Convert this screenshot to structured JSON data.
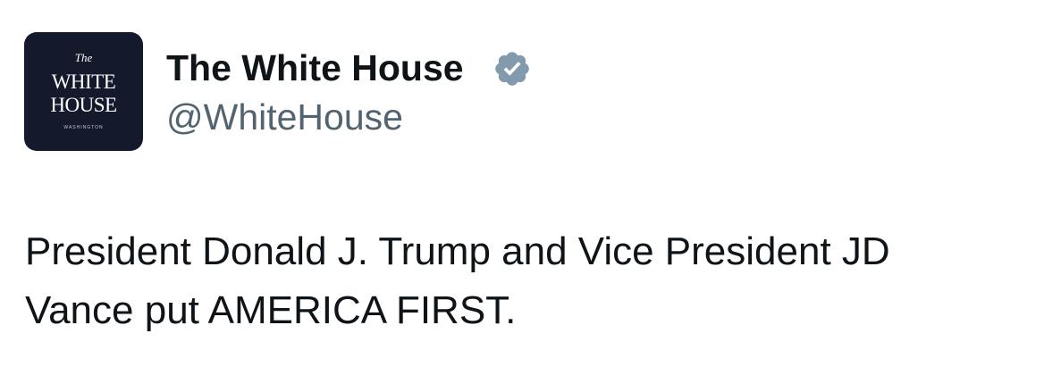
{
  "tweet": {
    "avatar": {
      "line_the": "The",
      "line_white": "WHITE",
      "line_house": "HOUSE",
      "line_location": "WASHINGTON",
      "background": "#141a2c"
    },
    "author": {
      "display_name": "The White House",
      "handle": "@WhiteHouse",
      "verified_icon": "verified-badge-icon",
      "badge_color": "#829aab"
    },
    "text_line1": "President Donald J. Trump and Vice President JD",
    "text_line2": "Vance put AMERICA FIRST."
  }
}
